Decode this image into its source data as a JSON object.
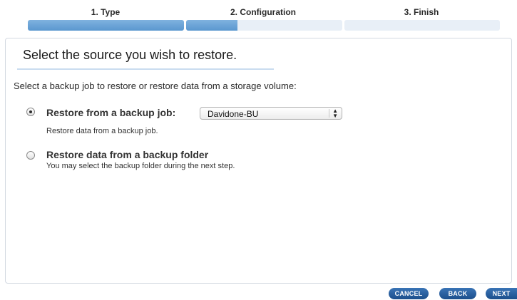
{
  "stepper": {
    "steps": [
      {
        "label": "1. Type",
        "status": "complete"
      },
      {
        "label": "2. Configuration",
        "status": "current"
      },
      {
        "label": "3. Finish",
        "status": "pending"
      }
    ],
    "progress": 0.46
  },
  "panel": {
    "title": "Select the source you wish to restore.",
    "instruction": "Select a backup job to restore or restore data from a storage volume:"
  },
  "options": [
    {
      "title": "Restore from a backup job:",
      "description": "Restore data from a backup job.",
      "selected": true,
      "select": {
        "value": "Davidone-BU"
      }
    },
    {
      "title": "Restore data from a backup folder",
      "description": "You may select the backup folder during the next step.",
      "selected": false
    }
  ],
  "footer": {
    "cancel_label": "CANCEL",
    "back_label": "BACK",
    "next_label": "NEXT"
  },
  "colors": {
    "progress_fill": "#5a97cf",
    "progress_track": "#e8eff7",
    "button": "#1c4f8c",
    "panel_border": "#d3d9e1"
  },
  "icons": {
    "select_arrows": "up-down-arrows-icon",
    "radio_checked": "radio-checked-icon",
    "radio_unchecked": "radio-unchecked-icon"
  }
}
